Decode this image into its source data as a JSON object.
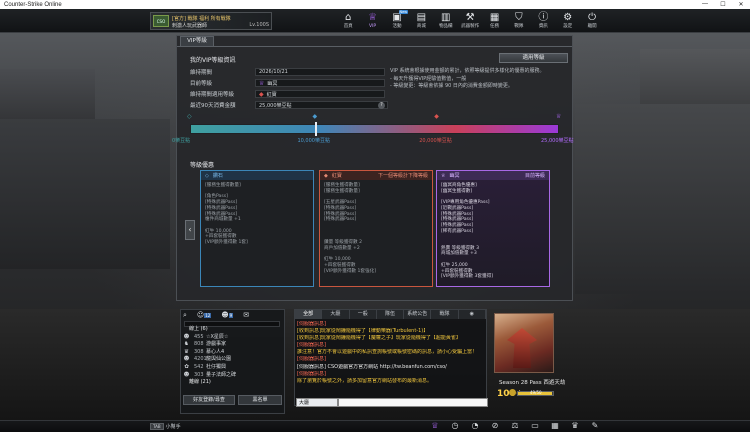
{
  "window": {
    "title": "Counter-Strike Online",
    "controls": [
      "—",
      "☐",
      "✕"
    ]
  },
  "profile": {
    "clan_badge": "CSO",
    "clan_line": "[官方] 戰隊 福利 所有戰隊",
    "name": "刺激人玩武器師",
    "level": "Lv.100S"
  },
  "nav": [
    {
      "label": "首頁",
      "icon": "home-icon",
      "glyph": "⌂",
      "active": false,
      "badge": ""
    },
    {
      "label": "VIP",
      "icon": "vip-icon",
      "glyph": "♕",
      "active": true,
      "badge": ""
    },
    {
      "label": "活動",
      "icon": "event-icon",
      "glyph": "▣",
      "active": false,
      "badge": "New"
    },
    {
      "label": "商城",
      "icon": "shop-icon",
      "glyph": "▤",
      "active": false,
      "badge": ""
    },
    {
      "label": "物品欄",
      "icon": "inventory-icon",
      "glyph": "▥",
      "active": false,
      "badge": ""
    },
    {
      "label": "武器製作",
      "icon": "craft-icon",
      "glyph": "⚒",
      "active": false,
      "badge": ""
    },
    {
      "label": "任務",
      "icon": "mission-icon",
      "glyph": "▦",
      "active": false,
      "badge": ""
    },
    {
      "label": "戰隊",
      "icon": "clan-icon",
      "glyph": "⛉",
      "active": false,
      "badge": ""
    },
    {
      "label": "資訊",
      "icon": "info-icon",
      "glyph": "ⓘ",
      "active": false,
      "badge": ""
    },
    {
      "label": "設定",
      "icon": "settings-icon",
      "glyph": "⚙",
      "active": false,
      "badge": ""
    },
    {
      "label": "離開",
      "icon": "power-icon",
      "glyph": "⏻",
      "active": false,
      "badge": ""
    }
  ],
  "vip": {
    "tab_label": "VIP等級",
    "section_title": "我的VIP等級資訊",
    "rules_button": "適用等級",
    "rows": [
      {
        "key": "維持期間",
        "value": "2026/10/21",
        "tier": ""
      },
      {
        "key": "目前等級",
        "value": "幽冥",
        "tier": "vip"
      },
      {
        "key": "維持期間適用等級",
        "value": "紅寶",
        "tier": "ruby"
      },
      {
        "key": "最近90天消費金額",
        "value": "25,000樂豆點",
        "tier": ""
      }
    ],
    "notes": [
      "VIP 系統會根據使用金額的累計，依照等級提供多樣化的優惠的服務。",
      "- 每天升獲得VIP經驗值數值，一般",
      "- 等級變更：等級會依據 90 日內的消費金額即時變更。"
    ],
    "progress": {
      "fraction": 0.34,
      "ticks": [
        {
          "label": "0樂豆點",
          "color": "#3fa0a0",
          "pos": 0.0,
          "glyph": "◇"
        },
        {
          "label": "10,000樂豆點",
          "color": "#4a9bd0",
          "pos": 0.34,
          "glyph": "◆"
        },
        {
          "label": "20,000樂豆點",
          "color": "#d9534f",
          "pos": 0.67,
          "glyph": "◆"
        },
        {
          "label": "25,000樂豆點",
          "color": "#b36cff",
          "pos": 1.0,
          "glyph": "♕"
        }
      ]
    },
    "benefits_title": "等級優惠",
    "cards": [
      {
        "name": "鑽石",
        "status": "",
        "body": "[服務生獲得數量]\n\n[角色Pass]\n[特殊武器Pass]\n[特殊武器Pass]\n[特殊武器Pass]\n槍件商城數量 +1\n\n紅牛 10,000\n+四套裝獲得數\n[VIP額外獲得數 1套]"
      },
      {
        "name": "紅寶",
        "status": "下一個等級計下降等級",
        "body": "[服務生獲得數量]\n[服務生獲得數量]\n\n[五星武器Pass]\n[特殊武器Pass]\n[特殊武器Pass]\n[特殊武器Pass]\n\n\n\n鑽量 等級獲得數 2\n商戶加值數量 +2\n\n紅牛 10,000\n+四套裝獲得數\n[VIP額外獲得數 1套強化]"
      },
      {
        "name": "幽冥",
        "status": "目前等級",
        "body": "[幽冥商角色優惠]\n[幽冥生獲得數]\n\n[VIP專用角色優惠Pass]\n[近戰武器Pass]\n[特殊武器Pass]\n[特殊武器Pass]\n[特殊武器Pass]\n[稀有武器Pass]\n\n\n熱賣 等級獲得數 3\n商城加值數量 +3\n\n紅牛 25,000\n+四套裝獲得數\n[VIP額外獲得數 3套獲得]"
      }
    ]
  },
  "friends": {
    "tab_counts": [
      "12",
      "9"
    ],
    "groups": [
      {
        "label": "線上 (6)",
        "members": [
          {
            "level": "455",
            "name": "☆X星辰☆",
            "avatar": "☻"
          },
          {
            "level": "808",
            "name": "游戲事家",
            "avatar": "♞"
          },
          {
            "level": "308",
            "name": "慕心人4",
            "avatar": "♛"
          },
          {
            "level": "4201",
            "name": "龍與仙公園",
            "avatar": "☻"
          },
          {
            "level": "542",
            "name": "杜仔獨興",
            "avatar": "✿"
          },
          {
            "level": "303",
            "name": "量子法師之碑",
            "avatar": "☻"
          }
        ]
      },
      {
        "label": "離線 (21)",
        "members": []
      }
    ],
    "add_button": "好友登錄/尋查",
    "blacklist_button": "黑名單"
  },
  "chat": {
    "tabs": [
      "全部",
      "大廳",
      "一般",
      "隊伍",
      "系統公告",
      "戰隊",
      "◉"
    ],
    "messages": [
      {
        "text": "[伺服器訊息]",
        "color": "c-red"
      },
      {
        "text": "[收到訊息]玩家從鬧鐘隨機得了【律動樂器(Turbulent-1)】",
        "color": "c-yel"
      },
      {
        "text": "[收到訊息]玩家從鬧鐘隨機得了【魔蘿之子】玩家從隨機得了【超能黃雀】",
        "color": "c-yel"
      },
      {
        "text": "[伺服器訊息]",
        "color": "c-red"
      },
      {
        "text": "誰注意！官方不會以遊戲中的私訊查詢帳號或帳號密碼的訊息，請小心受騙上當！",
        "color": "c-yel"
      },
      {
        "text": "[伺服器訊息]",
        "color": "c-red"
      },
      {
        "text": "[伺服器訊息] CSO遊戲官方官方網站 http://tw.beanfun.com/cso/",
        "color": "c-wh"
      },
      {
        "text": "[伺服器訊息]",
        "color": "c-red"
      },
      {
        "text": "除了瀏覽於帳號之外，請多加留意官方網站發布的最新消息。",
        "color": "c-yel"
      }
    ],
    "channel": "大廳",
    "input_placeholder": ""
  },
  "season": {
    "label": "Season 28 Pass 西遊天劫",
    "level": "100+",
    "progress_text": "49/50",
    "progress_fraction": 0.98
  },
  "bottom": {
    "helper_label": "小幫手",
    "helper_badge": "TAB",
    "icons": [
      {
        "name": "vip-small-icon",
        "glyph": "♕",
        "cls": "vip"
      },
      {
        "name": "quest-icon",
        "glyph": "◷",
        "cls": ""
      },
      {
        "name": "stopwatch-icon",
        "glyph": "◔",
        "cls": ""
      },
      {
        "name": "no-entry-icon",
        "glyph": "⊘",
        "cls": ""
      },
      {
        "name": "balance-icon",
        "glyph": "⚖",
        "cls": ""
      },
      {
        "name": "gamepad-icon",
        "glyph": "▭",
        "cls": ""
      },
      {
        "name": "calendar-icon",
        "glyph": "▦",
        "cls": ""
      },
      {
        "name": "trophy-icon",
        "glyph": "♛",
        "cls": ""
      },
      {
        "name": "tool-icon",
        "glyph": "✎",
        "cls": ""
      }
    ]
  }
}
